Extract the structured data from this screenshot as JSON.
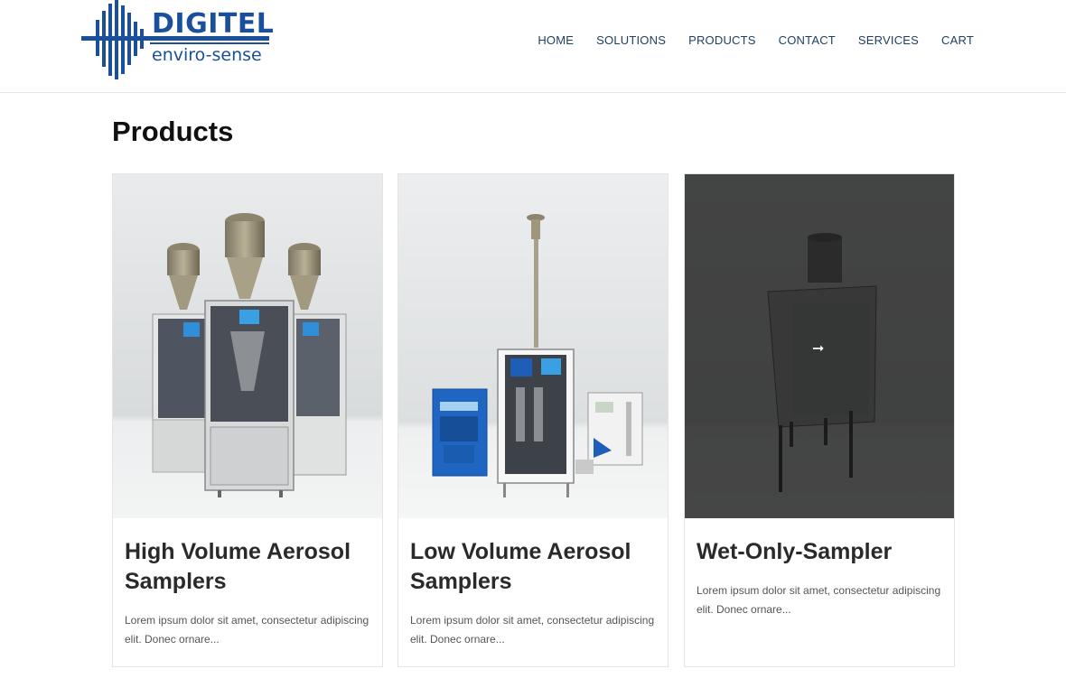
{
  "brand": {
    "name": "DIGITEL",
    "tagline": "enviro-sense",
    "color": "#1a4f9c"
  },
  "nav": {
    "items": [
      {
        "label": "HOME"
      },
      {
        "label": "SOLUTIONS"
      },
      {
        "label": "PRODUCTS"
      },
      {
        "label": "CONTACT"
      },
      {
        "label": "SERVICES"
      },
      {
        "label": "CART"
      }
    ],
    "color": "#1e3f66"
  },
  "page": {
    "title": "Products"
  },
  "products": [
    {
      "title": "High Volume Aerosol Samplers",
      "description": "Lorem ipsum dolor sit amet, consectetur adipiscing elit. Donec ornare...",
      "image_icon": "high-volume-sampler-photo"
    },
    {
      "title": "Low Volume Aerosol Samplers",
      "description": "Lorem ipsum dolor sit amet, consectetur adipiscing elit. Donec ornare...",
      "image_icon": "low-volume-sampler-photo"
    },
    {
      "title": "Wet-Only-Sampler",
      "description": "Lorem ipsum dolor sit amet, consectetur adipiscing elit. Donec ornare...",
      "image_icon": "wet-only-sampler-photo",
      "hover_arrow": "➞"
    }
  ]
}
